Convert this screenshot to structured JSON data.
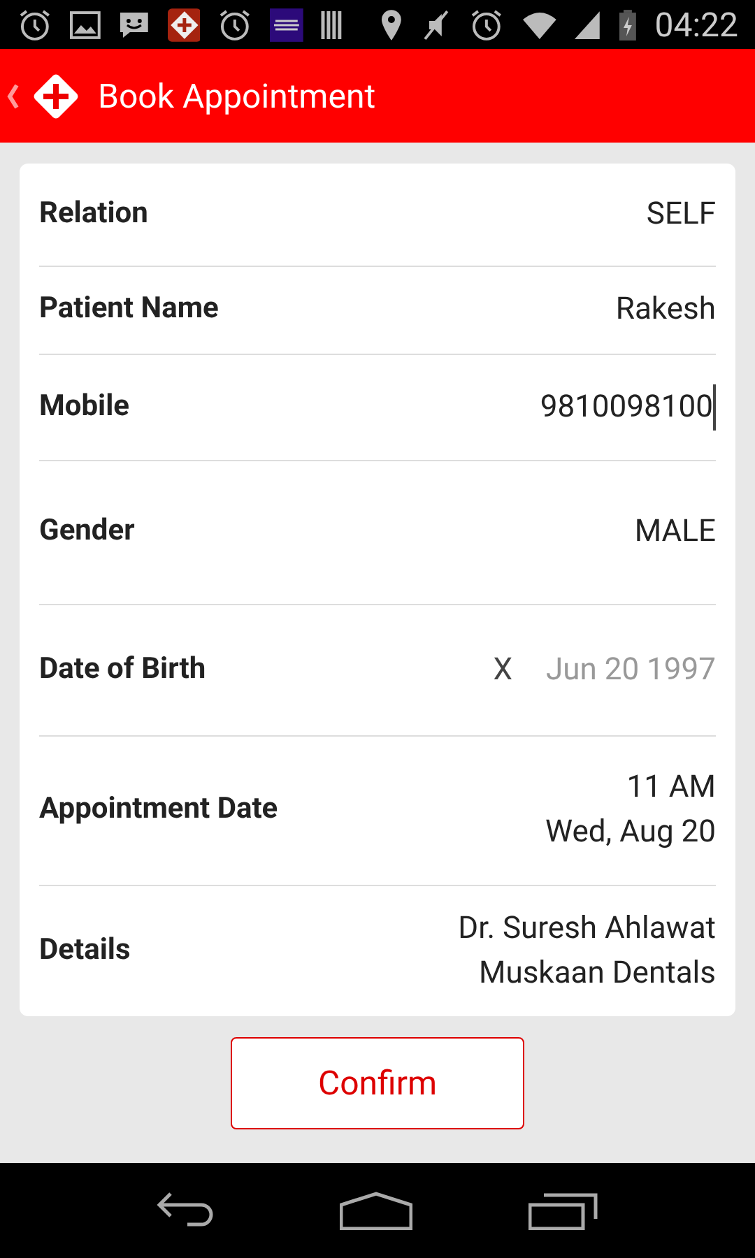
{
  "status_bar": {
    "time": "04:22"
  },
  "header": {
    "title": "Book Appointment"
  },
  "rows": [
    {
      "kind": "text",
      "label": "Relation",
      "values": [
        "SELF"
      ]
    },
    {
      "kind": "text",
      "label": "Patient Name",
      "values": [
        "Rakesh"
      ]
    },
    {
      "kind": "input",
      "label": "Mobile",
      "values": [
        "9810098100"
      ]
    },
    {
      "kind": "text",
      "label": "Gender",
      "values": [
        "MALE"
      ]
    },
    {
      "kind": "clearable",
      "label": "Date of Birth",
      "clear": "X",
      "values": [
        "Jun 20 1997"
      ]
    },
    {
      "kind": "text",
      "label": "Appointment Date",
      "values": [
        "11 AM",
        "Wed, Aug 20"
      ]
    },
    {
      "kind": "text",
      "label": "Details",
      "values": [
        "Dr. Suresh Ahlawat",
        "Muskaan Dentals"
      ]
    }
  ],
  "confirm_button": "Confirm"
}
